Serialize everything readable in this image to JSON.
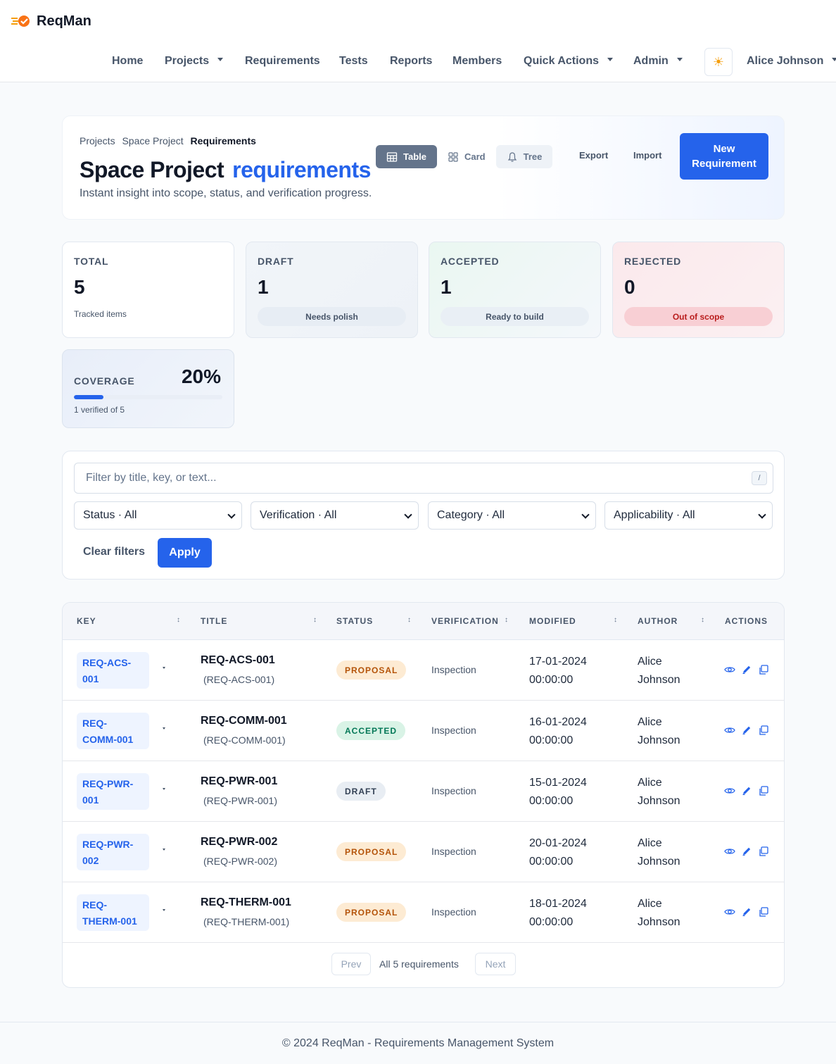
{
  "app": {
    "name": "ReqMan"
  },
  "nav": {
    "items": [
      {
        "label": "Home",
        "dropdown": false
      },
      {
        "label": "Projects",
        "dropdown": true
      },
      {
        "label": "Requirements",
        "dropdown": false
      },
      {
        "label": "Tests",
        "dropdown": false
      },
      {
        "label": "Reports",
        "dropdown": false
      },
      {
        "label": "Members",
        "dropdown": false
      },
      {
        "label": "Quick Actions",
        "dropdown": true
      },
      {
        "label": "Admin",
        "dropdown": true
      }
    ],
    "theme_icon": "☀",
    "user": "Alice Johnson"
  },
  "hero": {
    "breadcrumb": [
      "Projects",
      "Space Project",
      "Requirements"
    ],
    "title": "Space Project",
    "title_accent": "requirements",
    "subtitle": "Instant insight into scope, status, and verification progress.",
    "views": [
      "Table",
      "Card",
      "Tree"
    ],
    "export_label": "Export",
    "import_label": "Import",
    "new_label": "New Requirement"
  },
  "stats": {
    "total": {
      "label": "TOTAL",
      "value": "5",
      "hint": "Tracked items"
    },
    "draft": {
      "label": "DRAFT",
      "value": "1",
      "hint": "Needs polish"
    },
    "accepted": {
      "label": "ACCEPTED",
      "value": "1",
      "hint": "Ready to build"
    },
    "rejected": {
      "label": "REJECTED",
      "value": "0",
      "hint": "Out of scope"
    },
    "coverage": {
      "label": "COVERAGE",
      "value": "20%",
      "fraction": 0.2,
      "hint": "1 verified of 5"
    }
  },
  "filters": {
    "search_placeholder": "Filter by title, key, or text...",
    "shortcut": "/",
    "selects": [
      "Status · All",
      "Verification · All",
      "Category · All",
      "Applicability · All"
    ],
    "clear_label": "Clear filters",
    "apply_label": "Apply"
  },
  "table": {
    "headers": [
      "KEY",
      "TITLE",
      "STATUS",
      "VERIFICATION",
      "MODIFIED",
      "AUTHOR",
      "ACTIONS"
    ],
    "rows": [
      {
        "key_line1": "REQ-ACS-",
        "key_line2": "001",
        "title": "REQ-ACS-001",
        "sub": "(REQ-ACS-001)",
        "status": "PROPOSAL",
        "verification": "Inspection",
        "date": "17-01-2024",
        "time": "00:00:00",
        "author_first": "Alice",
        "author_last": "Johnson"
      },
      {
        "key_line1": "REQ-",
        "key_line2": "COMM-001",
        "title": "REQ-COMM-001",
        "sub": "(REQ-COMM-001)",
        "status": "ACCEPTED",
        "verification": "Inspection",
        "date": "16-01-2024",
        "time": "00:00:00",
        "author_first": "Alice",
        "author_last": "Johnson"
      },
      {
        "key_line1": "REQ-PWR-",
        "key_line2": "001",
        "title": "REQ-PWR-001",
        "sub": "(REQ-PWR-001)",
        "status": "DRAFT",
        "verification": "Inspection",
        "date": "15-01-2024",
        "time": "00:00:00",
        "author_first": "Alice",
        "author_last": "Johnson"
      },
      {
        "key_line1": "REQ-PWR-",
        "key_line2": "002",
        "title": "REQ-PWR-002",
        "sub": "(REQ-PWR-002)",
        "status": "PROPOSAL",
        "verification": "Inspection",
        "date": "20-01-2024",
        "time": "00:00:00",
        "author_first": "Alice",
        "author_last": "Johnson"
      },
      {
        "key_line1": "REQ-",
        "key_line2": "THERM-001",
        "title": "REQ-THERM-001",
        "sub": "(REQ-THERM-001)",
        "status": "PROPOSAL",
        "verification": "Inspection",
        "date": "18-01-2024",
        "time": "00:00:00",
        "author_first": "Alice",
        "author_last": "Johnson"
      }
    ],
    "pager": {
      "prev": "Prev",
      "info": "All 5 requirements",
      "next": "Next"
    }
  },
  "status_colors": {
    "PROPOSAL": {
      "bg": "#fdebd3",
      "fg": "#b45309"
    },
    "ACCEPTED": {
      "bg": "#d9f3e6",
      "fg": "#047857"
    },
    "DRAFT": {
      "bg": "#e8edf3",
      "fg": "#334155"
    }
  },
  "footer": {
    "text": "© 2024 ReqMan - Requirements Management System"
  }
}
